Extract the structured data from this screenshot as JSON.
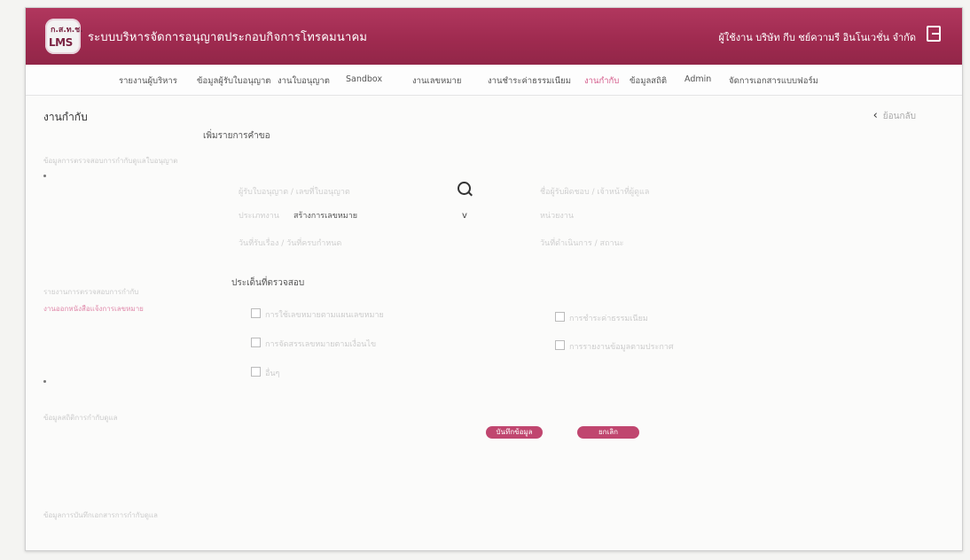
{
  "header": {
    "logo_text_top": "ก.ส.ท.ช.",
    "logo_text": "LMS",
    "app_title": "ระบบบริหารจัดการอนุญาตประกอบกิจการโทรคมนาคม",
    "user_label": "ผู้ใช้งาน  บริษัท กีบ ชย์ความรี อินโนเวชั่น จำกัด"
  },
  "nav": {
    "items": [
      {
        "label": "รายงานผู้บริหาร"
      },
      {
        "label": "ข้อมูลผู้รับใบอนุญาต"
      },
      {
        "label": "งานใบอนุญาต"
      },
      {
        "label": "Sandbox"
      },
      {
        "label": "งานเลขหมาย"
      },
      {
        "label": "งานชำระค่าธรรมเนียม"
      },
      {
        "label": "งานกำกับ"
      },
      {
        "label": "ข้อมูลสถิติ"
      },
      {
        "label": "Admin"
      },
      {
        "label": "จัดการเอกสารแบบฟอร์ม"
      }
    ],
    "active_index": 6
  },
  "page": {
    "title": "งานกำกับ",
    "back_label": "ย้อนกลับ",
    "form_heading": "เพิ่มรายการคำขอ"
  },
  "sidebar": {
    "items": [
      {
        "label": "ข้อมูลการตรวจสอบการกำกับดูแลใบอนุญาต"
      },
      {
        "label": "รายงานการตรวจสอบการกำกับ"
      },
      {
        "label": "งานออกหนังสือแจ้งการเลขหมาย"
      },
      {
        "label": "ข้อมูลสถิติการกำกับดูแล"
      },
      {
        "label": "ข้อมูลการบันทึกเอกสารการกำกับดูแล"
      }
    ]
  },
  "form": {
    "left_labels": [
      "ผู้รับใบอนุญาต / เลขที่ใบอนุญาต",
      "ประเภทงาน",
      "วันที่รับเรื่อง / วันที่ครบกำหนด"
    ],
    "type_value": "สร้างการเลขหมาย",
    "right_labels": [
      "ชื่อผู้รับผิดชอบ / เจ้าหน้าที่ผู้ดูแล",
      "หน่วยงาน",
      "วันที่ดำเนินการ / สถานะ"
    ]
  },
  "inspection": {
    "title": "ประเด็นที่ตรวจสอบ",
    "left_options": [
      "การใช้เลขหมายตามแผนเลขหมาย",
      "การจัดสรรเลขหมายตามเงื่อนไข",
      "อื่นๆ"
    ],
    "right_options": [
      "การชำระค่าธรรมเนียม",
      "การรายงานข้อมูลตามประกาศ"
    ]
  },
  "actions": {
    "save_label": "บันทึกข้อมูล",
    "cancel_label": "ยกเลิก"
  },
  "colors": {
    "header_bg": "#9e2a4f",
    "accent": "#c0466f",
    "active_nav": "#d45a8a"
  }
}
